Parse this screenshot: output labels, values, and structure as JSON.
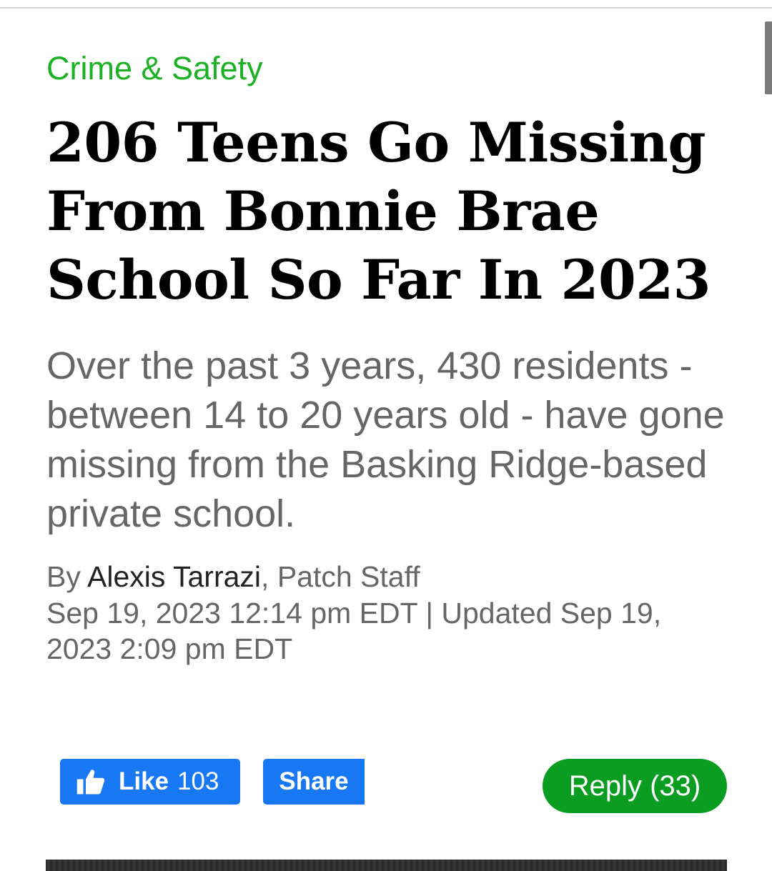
{
  "article": {
    "category": "Crime & Safety",
    "headline": "206 Teens Go Missing From Bonnie Brae School So Far In 2023",
    "dek": "Over the past 3 years, 430 residents - between 14 to 20 years old - have gone missing from the Basking Ridge-based private school.",
    "byline": {
      "prefix": "By ",
      "author": "Alexis Tarrazi",
      "role": ", Patch Staff"
    },
    "dateline": "Sep 19, 2023 12:14 pm EDT | Updated Sep 19, 2023 2:09 pm EDT"
  },
  "actions": {
    "like_label": "Like",
    "like_count": "103",
    "share_label": "Share",
    "reply_label": "Reply (33)"
  },
  "icons": {
    "like": "thumbs-up-icon"
  },
  "colors": {
    "category": "#1bb124",
    "facebook_blue": "#1877f2",
    "reply_green": "#0a9d22"
  }
}
